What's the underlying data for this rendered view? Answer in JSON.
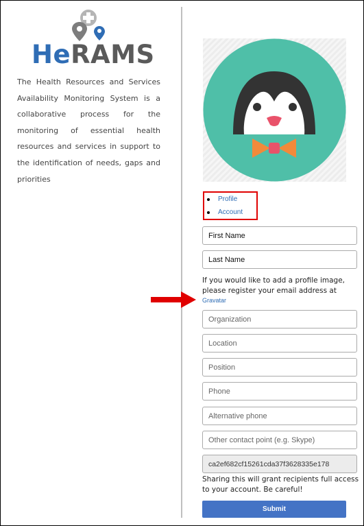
{
  "app": {
    "logo_text_a": "He",
    "logo_text_b": "RAMS",
    "description": "The Health Resources and Services Availability Monitoring System is a collaborative process for the monitoring of essential health resources and services in support to the identification of needs, gaps and priorities"
  },
  "nav": {
    "profile_label": "Profile",
    "account_label": "Account"
  },
  "form": {
    "first_name_placeholder": "First Name",
    "last_name_placeholder": "Last Name",
    "profile_image_note": "If you would like to add a profile image, please register your email address at",
    "gravatar_link": "Gravatar",
    "organization_placeholder": "Organization",
    "location_placeholder": "Location",
    "position_placeholder": "Position",
    "phone_placeholder": "Phone",
    "alt_phone_placeholder": "Alternative phone",
    "other_contact_placeholder": "Other contact point (e.g. Skype)",
    "access_key_value": "ca2ef682cf15261cda37f3628335e178",
    "warning": "Sharing this will grant recipients full access to your account. Be careful!",
    "submit_label": "Submit"
  },
  "colors": {
    "brand_blue": "#2f6db5",
    "avatar_teal": "#4fbfa8",
    "highlight_red": "#e00000",
    "button_blue": "#4473c5"
  }
}
